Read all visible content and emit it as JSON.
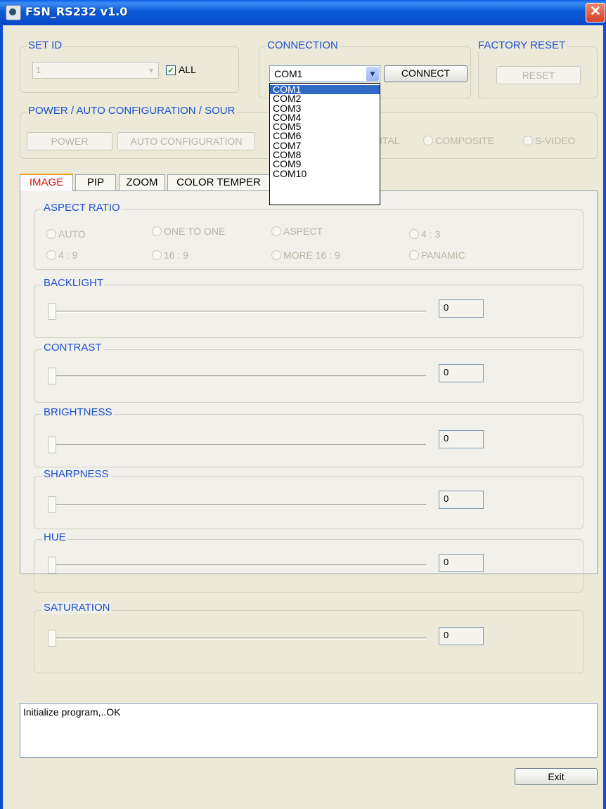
{
  "window": {
    "title": "FSN_RS232 v1.0",
    "close_glyph": "✕"
  },
  "set_id": {
    "label": "SET ID",
    "value": "1",
    "all_checked": true,
    "all_label": "ALL"
  },
  "connection": {
    "label": "CONNECTION",
    "port": "COM1",
    "connect_label": "CONNECT",
    "options": [
      "COM1",
      "COM2",
      "COM3",
      "COM4",
      "COM5",
      "COM6",
      "COM7",
      "COM8",
      "COM9",
      "COM10"
    ]
  },
  "factory_reset": {
    "label": "FACTORY RESET",
    "reset_label": "RESET"
  },
  "power_group": {
    "label": "POWER / AUTO CONFIGURATION / SOUR",
    "power_label": "POWER",
    "auto_config_label": "AUTO CONFIGURATION",
    "sources": [
      "ITAL",
      "COMPOSITE",
      "S-VIDEO"
    ]
  },
  "tabs": [
    "IMAGE",
    "PIP",
    "ZOOM",
    "COLOR TEMPER"
  ],
  "aspect_ratio": {
    "label": "ASPECT RATIO",
    "options": [
      "AUTO",
      "ONE TO ONE",
      "ASPECT",
      "4 : 3",
      "4 : 9",
      "16 : 9",
      "MORE 16 : 9",
      "PANAMIC"
    ]
  },
  "sliders": [
    {
      "label": "BACKLIGHT",
      "value": "0"
    },
    {
      "label": "CONTRAST",
      "value": "0"
    },
    {
      "label": "BRIGHTNESS",
      "value": "0"
    },
    {
      "label": "SHARPNESS",
      "value": "0"
    },
    {
      "label": "HUE",
      "value": "0"
    },
    {
      "label": "SATURATION",
      "value": "0"
    }
  ],
  "log": {
    "text": "Initialize program,..OK"
  },
  "exit_label": "Exit",
  "colors": {
    "titlebar": "#0a5fe8",
    "group_label": "#1e4fcf",
    "active_tab": "#e0140e",
    "selection": "#316ac5"
  }
}
